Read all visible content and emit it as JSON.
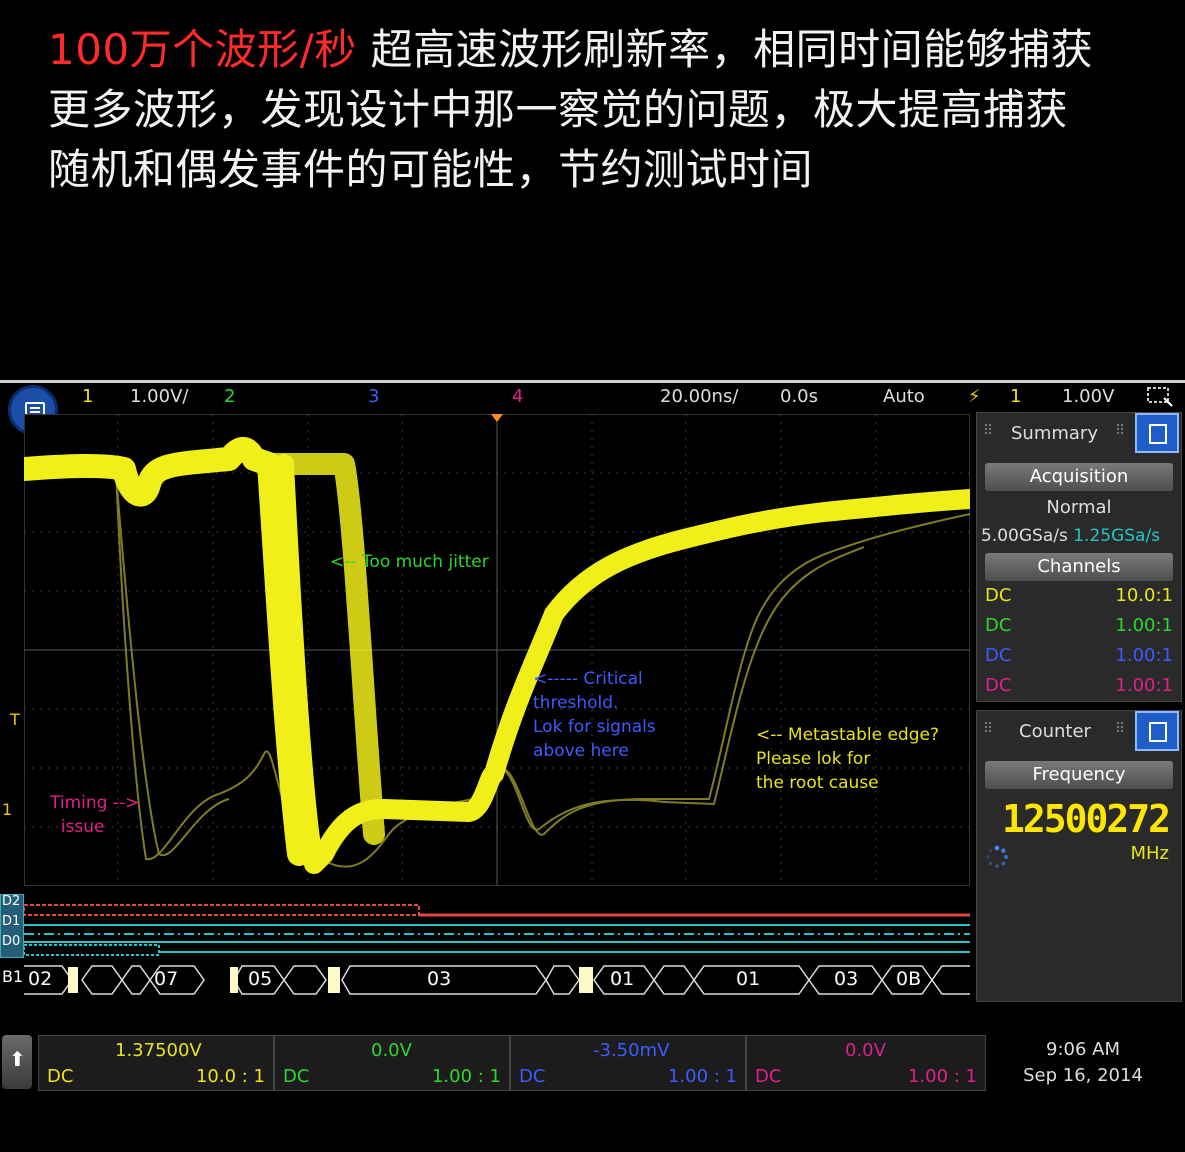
{
  "headline": {
    "highlight": "100万个波形/秒",
    "line1_rest": " 超高速波形刷新率，相同时间能够捕获",
    "line2": "更多波形，发现设计中那一察觉的问题，极大提高捕获",
    "line3": "随机和偶发事件的可能性，节约测试时间"
  },
  "status": {
    "ch1_num": "1",
    "ch1_scale": "1.00V/",
    "ch2_num": "2",
    "ch3_num": "3",
    "ch4_num": "4",
    "timebase": "20.00ns/",
    "delay": "0.0s",
    "trigger_mode": "Auto",
    "trig_source": "1",
    "trig_level": "1.00V"
  },
  "annotations": {
    "jitter": "<-- Too much jitter",
    "critical": "<----- Critical\nthreshold.\nLok for signals\nabove here",
    "metastable": "<-- Metastable edge?\nPlease lok for\nthe root cause",
    "timing": "Timing -->\n  issue"
  },
  "side_markers": {
    "trigger": "T",
    "ch1_marker": "1"
  },
  "digital": {
    "labels": [
      "D2",
      "D1",
      "D0"
    ],
    "bus_label": "B1",
    "bus_values": [
      "02",
      "07",
      "05",
      "03",
      "01",
      "01",
      "03",
      "0B"
    ]
  },
  "summary_panel": {
    "title": "Summary",
    "acquisition_label": "Acquisition",
    "acq_mode": "Normal",
    "rate_max": "5.00GSa/s",
    "rate_cur": "1.25GSa/s",
    "channels_label": "Channels",
    "channels": [
      {
        "coupling": "DC",
        "probe": "10.0:1",
        "color": "#e8e31a"
      },
      {
        "coupling": "DC",
        "probe": "1.00:1",
        "color": "#2ed52e"
      },
      {
        "coupling": "DC",
        "probe": "1.00:1",
        "color": "#3d5cff"
      },
      {
        "coupling": "DC",
        "probe": "1.00:1",
        "color": "#e0208a"
      }
    ]
  },
  "counter_panel": {
    "title": "Counter",
    "frequency_label": "Frequency",
    "value": "12500272",
    "unit": "MHz"
  },
  "channel_bar": [
    {
      "offset": "1.37500V",
      "coupling": "DC",
      "probe": "10.0 : 1",
      "color": "#e8e31a"
    },
    {
      "offset": "0.0V",
      "coupling": "DC",
      "probe": "1.00 : 1",
      "color": "#2ed52e"
    },
    {
      "offset": "-3.50mV",
      "coupling": "DC",
      "probe": "1.00 : 1",
      "color": "#3d5cff"
    },
    {
      "offset": "0.0V",
      "coupling": "DC",
      "probe": "1.00 : 1",
      "color": "#e0208a"
    }
  ],
  "clock": {
    "time": "9:06 AM",
    "date": "Sep 16, 2014"
  },
  "colors": {
    "ch1": "#e8e31a",
    "ch2": "#2ed52e",
    "ch3": "#3d5cff",
    "ch4": "#e0208a",
    "headline_highlight": "#ff2a2a"
  }
}
